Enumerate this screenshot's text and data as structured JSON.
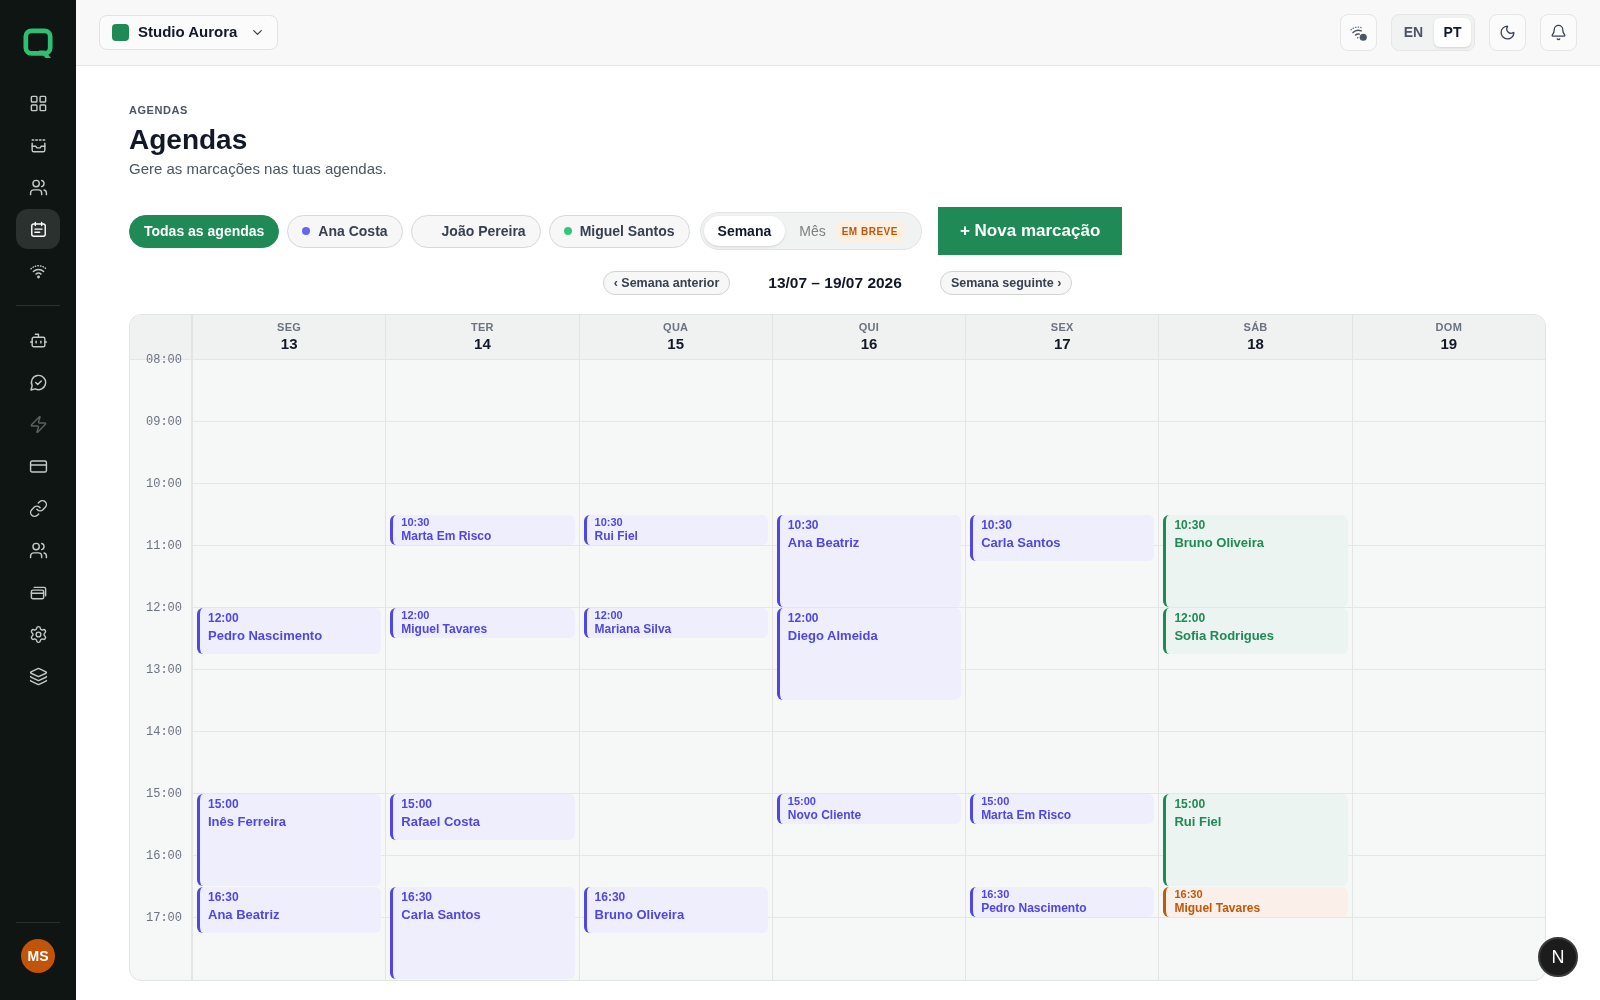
{
  "sidebar": {
    "items": [
      {
        "selected": false
      },
      {
        "selected": false
      },
      {
        "selected": false
      },
      {
        "selected": true
      },
      {
        "selected": false
      }
    ],
    "tools": [
      {
        "selected": false,
        "disabled": false
      },
      {
        "selected": false,
        "disabled": false
      },
      {
        "selected": false,
        "disabled": true
      },
      {
        "selected": false,
        "disabled": false
      },
      {
        "selected": false,
        "disabled": false
      },
      {
        "selected": false,
        "disabled": false
      },
      {
        "selected": false,
        "disabled": false
      },
      {
        "selected": false,
        "disabled": false
      },
      {
        "selected": false,
        "disabled": false
      }
    ],
    "avatar": "MS"
  },
  "header": {
    "workspace": "Studio Aurora",
    "languages": [
      {
        "label": "EN",
        "selected": false
      },
      {
        "label": "PT",
        "selected": true
      }
    ]
  },
  "page": {
    "eyebrow": "AGENDAS",
    "title": "Agendas",
    "subtitle": "Gere as marcações nas tuas agendas."
  },
  "filters": [
    {
      "kind": "all",
      "label": "Todas as agendas",
      "selected": true
    },
    {
      "kind": "agenda",
      "label": "Ana Costa",
      "selected": false,
      "color": "#6366f1"
    },
    {
      "kind": "agenda",
      "label": "João Pereira",
      "selected": false
    },
    {
      "kind": "agenda",
      "label": "Miguel Santos",
      "selected": false,
      "color": "#34c77b"
    }
  ],
  "view_modes": [
    {
      "label": "Semana",
      "selected": true,
      "disabled": false
    },
    {
      "label": "Mês",
      "selected": false,
      "disabled": true,
      "badge": "EM BREVE"
    }
  ],
  "new_button": "+ Nova marcação",
  "week_nav": {
    "previous": "‹ Semana anterior",
    "range": "13/07 – 19/07 2026",
    "next": "Semana seguinte ›"
  },
  "calendar": {
    "hours": [
      "08:00",
      "09:00",
      "10:00",
      "11:00",
      "12:00",
      "13:00",
      "14:00",
      "15:00",
      "16:00",
      "17:00"
    ],
    "days": [
      {
        "weekday": "SEG",
        "date": "13",
        "events": [
          {
            "kind": "medium",
            "time": "12:00",
            "name": "Pedro Nascimento",
            "color": "#4f46e5"
          },
          {
            "kind": "long",
            "time": "15:00",
            "name": "Inês Ferreira",
            "color": "#4f46e5"
          },
          {
            "kind": "medium",
            "time": "16:30",
            "name": "Ana Beatriz",
            "color": "#4f46e5"
          }
        ]
      },
      {
        "weekday": "TER",
        "date": "14",
        "events": [
          {
            "kind": "short",
            "time": "10:30",
            "name": "Marta Em Risco",
            "color": "#4f46e5"
          },
          {
            "kind": "short",
            "time": "12:00",
            "name": "Miguel Tavares",
            "color": "#4f46e5"
          },
          {
            "kind": "medium",
            "time": "15:00",
            "name": "Rafael Costa",
            "color": "#4f46e5"
          },
          {
            "kind": "long",
            "time": "16:30",
            "name": "Carla Santos",
            "color": "#4f46e5"
          }
        ]
      },
      {
        "weekday": "QUA",
        "date": "15",
        "events": [
          {
            "kind": "short",
            "time": "10:30",
            "name": "Rui Fiel",
            "color": "#4f46e5"
          },
          {
            "kind": "short",
            "time": "12:00",
            "name": "Mariana Silva",
            "color": "#4f46e5"
          },
          {
            "kind": "medium",
            "time": "16:30",
            "name": "Bruno Oliveira",
            "color": "#4f46e5"
          }
        ]
      },
      {
        "weekday": "QUI",
        "date": "16",
        "events": [
          {
            "kind": "long",
            "time": "10:30",
            "name": "Ana Beatriz",
            "color": "#4f46e5"
          },
          {
            "kind": "long",
            "time": "12:00",
            "name": "Diego Almeida",
            "color": "#4f46e5"
          },
          {
            "kind": "short",
            "time": "15:00",
            "name": "Novo Cliente",
            "color": "#4f46e5"
          }
        ]
      },
      {
        "weekday": "SEX",
        "date": "17",
        "events": [
          {
            "kind": "medium",
            "time": "10:30",
            "name": "Carla Santos",
            "color": "#4f46e5"
          },
          {
            "kind": "short",
            "time": "15:00",
            "name": "Marta Em Risco",
            "color": "#4f46e5"
          },
          {
            "kind": "short",
            "time": "16:30",
            "name": "Pedro Nascimento",
            "color": "#4f46e5"
          }
        ]
      },
      {
        "weekday": "SÁB",
        "date": "18",
        "events": [
          {
            "kind": "long",
            "time": "10:30",
            "name": "Bruno Oliveira",
            "color": "#1f8a55"
          },
          {
            "kind": "medium",
            "time": "12:00",
            "name": "Sofia Rodrigues",
            "color": "#1f8a55"
          },
          {
            "kind": "long",
            "time": "15:00",
            "name": "Rui Fiel",
            "color": "#1f8a55"
          },
          {
            "kind": "short",
            "time": "16:30",
            "name": "Miguel Tavares",
            "color": "#c2570c"
          }
        ]
      },
      {
        "weekday": "DOM",
        "date": "19"
      }
    ]
  },
  "dev_badge": "N"
}
